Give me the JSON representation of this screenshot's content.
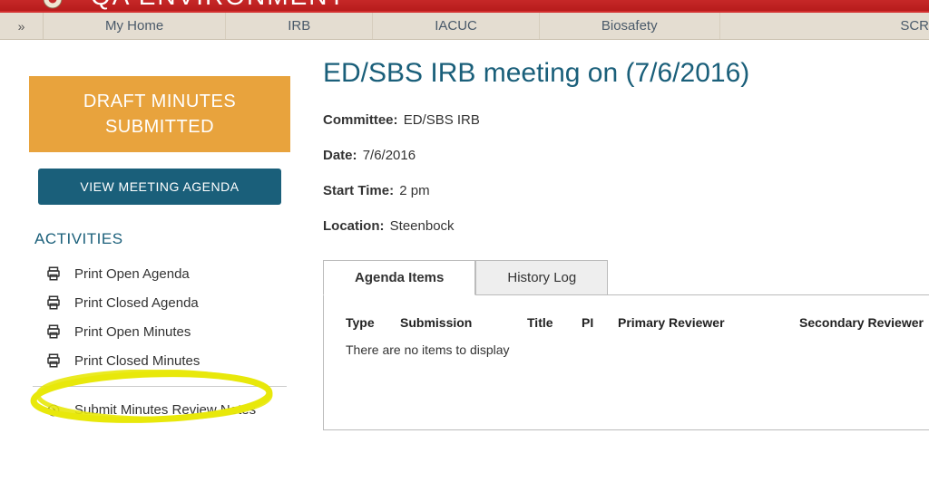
{
  "header": {
    "title": "QA ENVIRONMENT"
  },
  "nav": {
    "items": [
      "My Home",
      "IRB",
      "IACUC",
      "Biosafety",
      "SCR"
    ]
  },
  "sidebar": {
    "status": "DRAFT MINUTES\nSUBMITTED",
    "view_agenda": "VIEW MEETING AGENDA",
    "activities_heading": "ACTIVITIES",
    "activities": [
      "Print Open Agenda",
      "Print Closed Agenda",
      "Print Open Minutes",
      "Print Closed Minutes"
    ],
    "submit_notes": "Submit Minutes Review Notes"
  },
  "main": {
    "title": "ED/SBS IRB meeting on (7/6/2016)",
    "committee_label": "Committee:",
    "committee_value": "ED/SBS IRB",
    "date_label": "Date:",
    "date_value": "7/6/2016",
    "start_label": "Start Time:",
    "start_value": "2 pm",
    "location_label": "Location:",
    "location_value": "Steenbock",
    "tabs": [
      "Agenda Items",
      "History Log"
    ],
    "grid": {
      "headers": [
        "Type",
        "Submission",
        "Title",
        "PI",
        "Primary Reviewer",
        "Secondary Reviewer"
      ],
      "empty": "There are no items to display"
    }
  }
}
